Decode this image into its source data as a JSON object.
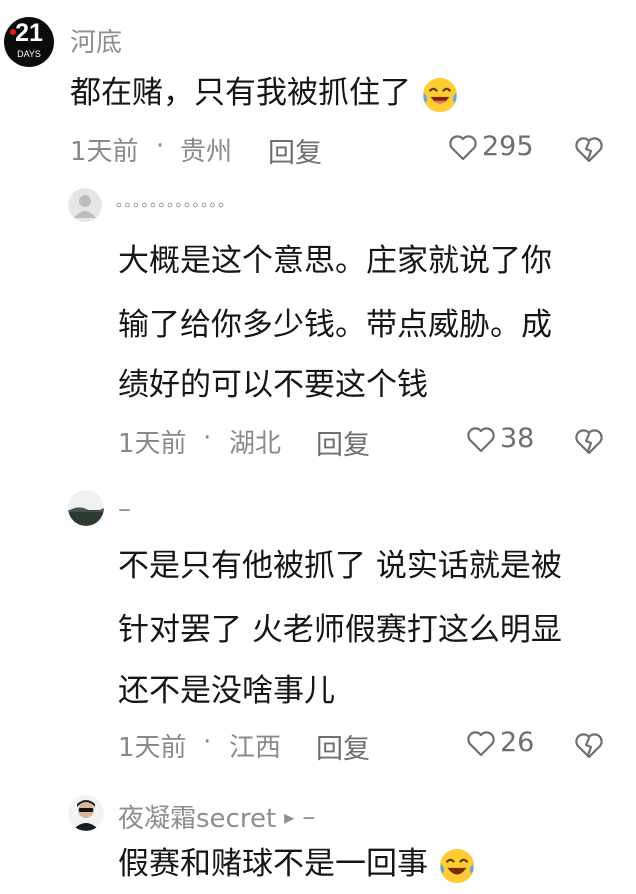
{
  "comments": [
    {
      "username": "河底",
      "avatar_label": "21",
      "avatar_sublabel": "DAYS",
      "text": "都在赌，只有我被抓住了",
      "emoji": "laughing-crying-emoji",
      "time": "1天前",
      "separator": "·",
      "location": "贵州",
      "reply_label": "回复",
      "likes": "295"
    },
    {
      "username": "。。。。。。。。。。。。。",
      "avatar": "default-user-avatar",
      "lines": [
        "大概是这个意思。庄家就说了你",
        "输了给你多少钱。带点威胁。成",
        "绩好的可以不要这个钱"
      ],
      "time": "1天前",
      "separator": "·",
      "location": "湖北",
      "reply_label": "回复",
      "likes": "38"
    },
    {
      "username": "–",
      "avatar": "landscape-avatar",
      "lines": [
        "不是只有他被抓了 说实话就是被",
        "针对罢了 火老师假赛打这么明显",
        "还不是没啥事儿"
      ],
      "time": "1天前",
      "separator": "·",
      "location": "江西",
      "reply_label": "回复",
      "likes": "26"
    },
    {
      "username": "夜凝霜secret",
      "reply_arrow": "▸",
      "reply_target": "–",
      "text": "假赛和赌球不是一回事",
      "emoji": "laughing-crying-emoji"
    }
  ],
  "colors": {
    "text": "#161616",
    "meta": "#8a8a8a",
    "icon": "#6f6f6f"
  }
}
